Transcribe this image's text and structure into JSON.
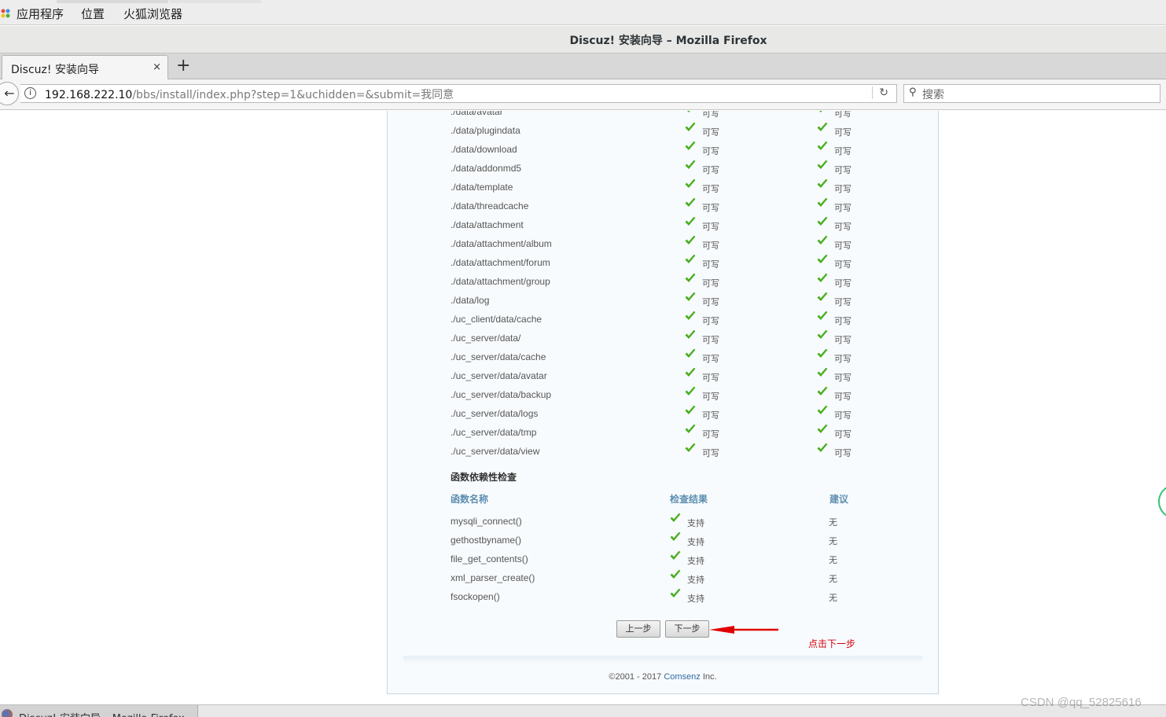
{
  "system": {
    "menus": [
      "应用程序",
      "位置",
      "火狐浏览器"
    ]
  },
  "window": {
    "title": "Discuz! 安装向导 – Mozilla Firefox"
  },
  "browser": {
    "tab_title": "Discuz! 安装向导",
    "tab_close": "×",
    "new_tab": "+",
    "url_host": "192.168.222.10",
    "url_rest": "/bbs/install/index.php?step=1&uchidden=&submit=我同意",
    "search_placeholder": "搜索"
  },
  "dir_check": {
    "rows": [
      {
        "path": "./data/avatar",
        "current": "可写",
        "required": "可写"
      },
      {
        "path": "./data/plugindata",
        "current": "可写",
        "required": "可写"
      },
      {
        "path": "./data/download",
        "current": "可写",
        "required": "可写"
      },
      {
        "path": "./data/addonmd5",
        "current": "可写",
        "required": "可写"
      },
      {
        "path": "./data/template",
        "current": "可写",
        "required": "可写"
      },
      {
        "path": "./data/threadcache",
        "current": "可写",
        "required": "可写"
      },
      {
        "path": "./data/attachment",
        "current": "可写",
        "required": "可写"
      },
      {
        "path": "./data/attachment/album",
        "current": "可写",
        "required": "可写"
      },
      {
        "path": "./data/attachment/forum",
        "current": "可写",
        "required": "可写"
      },
      {
        "path": "./data/attachment/group",
        "current": "可写",
        "required": "可写"
      },
      {
        "path": "./data/log",
        "current": "可写",
        "required": "可写"
      },
      {
        "path": "./uc_client/data/cache",
        "current": "可写",
        "required": "可写"
      },
      {
        "path": "./uc_server/data/",
        "current": "可写",
        "required": "可写"
      },
      {
        "path": "./uc_server/data/cache",
        "current": "可写",
        "required": "可写"
      },
      {
        "path": "./uc_server/data/avatar",
        "current": "可写",
        "required": "可写"
      },
      {
        "path": "./uc_server/data/backup",
        "current": "可写",
        "required": "可写"
      },
      {
        "path": "./uc_server/data/logs",
        "current": "可写",
        "required": "可写"
      },
      {
        "path": "./uc_server/data/tmp",
        "current": "可写",
        "required": "可写"
      },
      {
        "path": "./uc_server/data/view",
        "current": "可写",
        "required": "可写"
      }
    ]
  },
  "func_check": {
    "title": "函数依赖性检查",
    "headers": {
      "name": "函数名称",
      "result": "检查结果",
      "advice": "建议"
    },
    "rows": [
      {
        "name": "mysqli_connect()",
        "result": "支持",
        "advice": "无"
      },
      {
        "name": "gethostbyname()",
        "result": "支持",
        "advice": "无"
      },
      {
        "name": "file_get_contents()",
        "result": "支持",
        "advice": "无"
      },
      {
        "name": "xml_parser_create()",
        "result": "支持",
        "advice": "无"
      },
      {
        "name": "fsockopen()",
        "result": "支持",
        "advice": "无"
      }
    ]
  },
  "buttons": {
    "prev": "上一步",
    "next": "下一步"
  },
  "annotation": "点击下一步",
  "footer": {
    "before": "©2001 - 2017 ",
    "link": "Comsenz",
    "after": " Inc."
  },
  "taskbar": {
    "label": "Discuz! 安装向导 – Mozilla Firefox"
  },
  "watermark": "CSDN @qq_52825616",
  "colors": {
    "check": "#49b020",
    "annotation": "#d4000a",
    "link": "#2e6ca3",
    "header": "#5c8eb0"
  },
  "icons": [
    "apps-icon",
    "close-icon",
    "plus-icon",
    "back-icon",
    "info-icon",
    "reload-icon",
    "search-icon",
    "checkmark-icon",
    "arrow-icon"
  ]
}
